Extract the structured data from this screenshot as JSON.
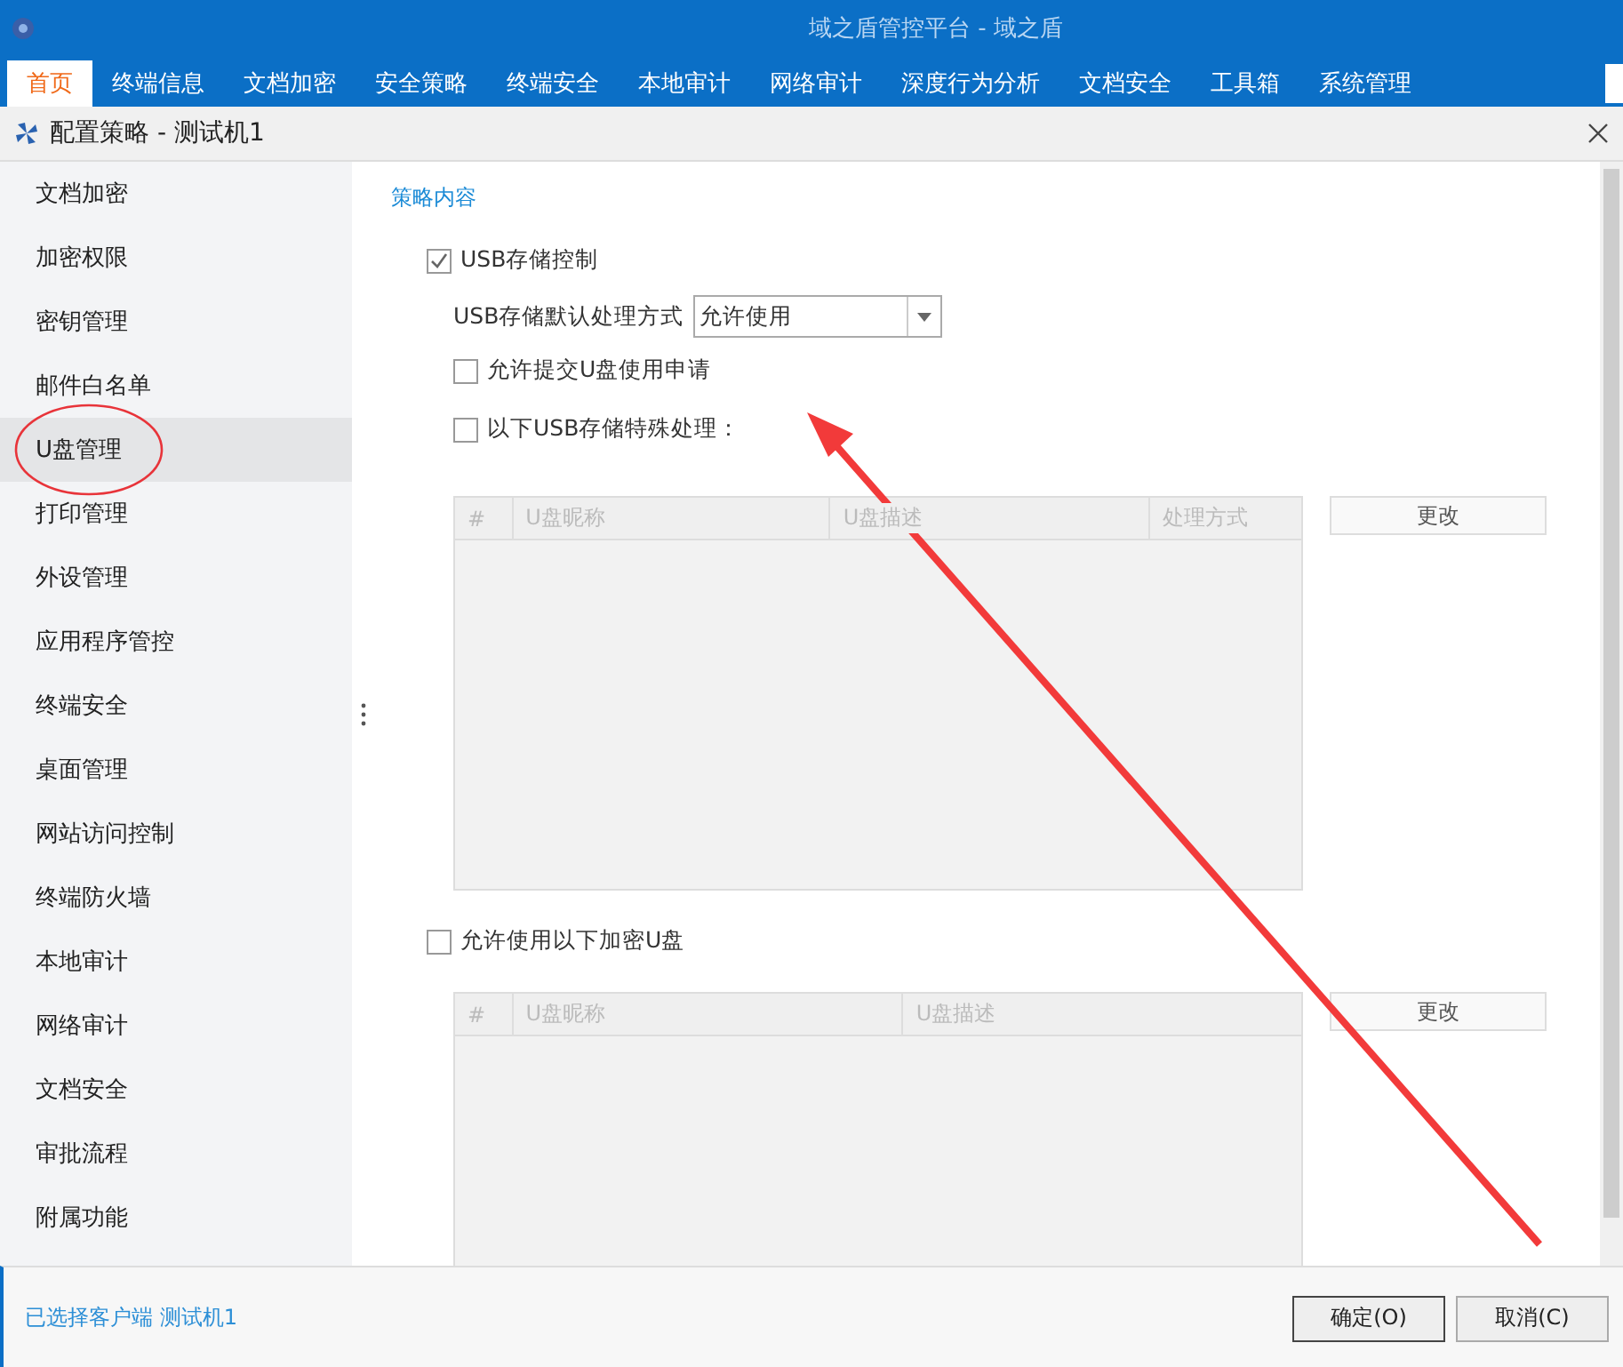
{
  "app_title": "域之盾管控平台 - 域之盾",
  "menu": [
    {
      "label": "首页",
      "selected": true
    },
    {
      "label": "终端信息",
      "selected": false
    },
    {
      "label": "文档加密",
      "selected": false
    },
    {
      "label": "安全策略",
      "selected": false
    },
    {
      "label": "终端安全",
      "selected": false
    },
    {
      "label": "本地审计",
      "selected": false
    },
    {
      "label": "网络审计",
      "selected": false
    },
    {
      "label": "深度行为分析",
      "selected": false
    },
    {
      "label": "文档安全",
      "selected": false
    },
    {
      "label": "工具箱",
      "selected": false
    },
    {
      "label": "系统管理",
      "selected": false
    }
  ],
  "dialog": {
    "title": "配置策略 - 测试机1"
  },
  "sidebar": {
    "items": [
      {
        "label": "文档加密",
        "selected": false
      },
      {
        "label": "加密权限",
        "selected": false
      },
      {
        "label": "密钥管理",
        "selected": false
      },
      {
        "label": "邮件白名单",
        "selected": false
      },
      {
        "label": "U盘管理",
        "selected": true
      },
      {
        "label": "打印管理",
        "selected": false
      },
      {
        "label": "外设管理",
        "selected": false
      },
      {
        "label": "应用程序管控",
        "selected": false
      },
      {
        "label": "终端安全",
        "selected": false
      },
      {
        "label": "桌面管理",
        "selected": false
      },
      {
        "label": "网站访问控制",
        "selected": false
      },
      {
        "label": "终端防火墙",
        "selected": false
      },
      {
        "label": "本地审计",
        "selected": false
      },
      {
        "label": "网络审计",
        "selected": false
      },
      {
        "label": "文档安全",
        "selected": false
      },
      {
        "label": "审批流程",
        "selected": false
      },
      {
        "label": "附属功能",
        "selected": false
      }
    ]
  },
  "content": {
    "section_title": "策略内容",
    "usb_control": {
      "label": "USB存储控制",
      "checked": true
    },
    "default_mode": {
      "label": "USB存储默认处理方式",
      "value": "允许使用"
    },
    "options": [
      {
        "label": "允许提交U盘使用申请",
        "checked": false
      },
      {
        "label": "以下USB存储特殊处理：",
        "checked": false
      }
    ],
    "table1": {
      "columns": [
        "#",
        "U盘昵称",
        "U盘描述",
        "处理方式"
      ],
      "button": "更改"
    },
    "encrypted": {
      "label": "允许使用以下加密U盘",
      "checked": false
    },
    "table2": {
      "columns": [
        "#",
        "U盘昵称",
        "U盘描述"
      ],
      "button": "更改"
    }
  },
  "status": "已选择客户端 测试机1",
  "buttons": [
    "确定(O)",
    "取消(C)"
  ]
}
